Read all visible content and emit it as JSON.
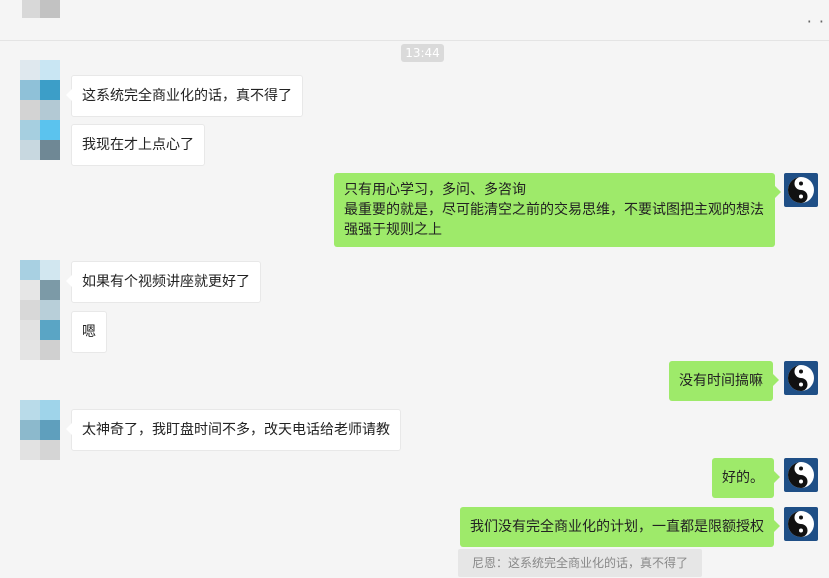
{
  "header": {
    "more_icon": "more-icon"
  },
  "timestamp": "13:44",
  "messages": [
    {
      "side": "in",
      "text": "这系统完全商业化的话，真不得了"
    },
    {
      "side": "in",
      "text": "我现在才上点心了"
    },
    {
      "side": "out",
      "text": "只有用心学习，多问、多咨询\n最重要的就是，尽可能清空之前的交易思维，不要试图把主观的想法\n强强于规则之上"
    },
    {
      "side": "in",
      "text": "如果有个视频讲座就更好了"
    },
    {
      "side": "in",
      "text": "嗯"
    },
    {
      "side": "out",
      "text": "没有时间搞嘛"
    },
    {
      "side": "in",
      "text": "太神奇了，我盯盘时间不多，改天电话给老师请教"
    },
    {
      "side": "out",
      "text": "好的。"
    },
    {
      "side": "out",
      "text": "我们没有完全商业化的计划，一直都是限额授权"
    }
  ],
  "quote": "尼恩：这系统完全商业化的话，真不得了",
  "colors": {
    "bubble_out": "#9eea6a",
    "bubble_in": "#ffffff",
    "background": "#f5f5f5",
    "avatar_me": "#1f4f86"
  },
  "icons": {
    "my_avatar": "yin-yang-icon",
    "contact_avatar": "pixelated-avatar"
  }
}
